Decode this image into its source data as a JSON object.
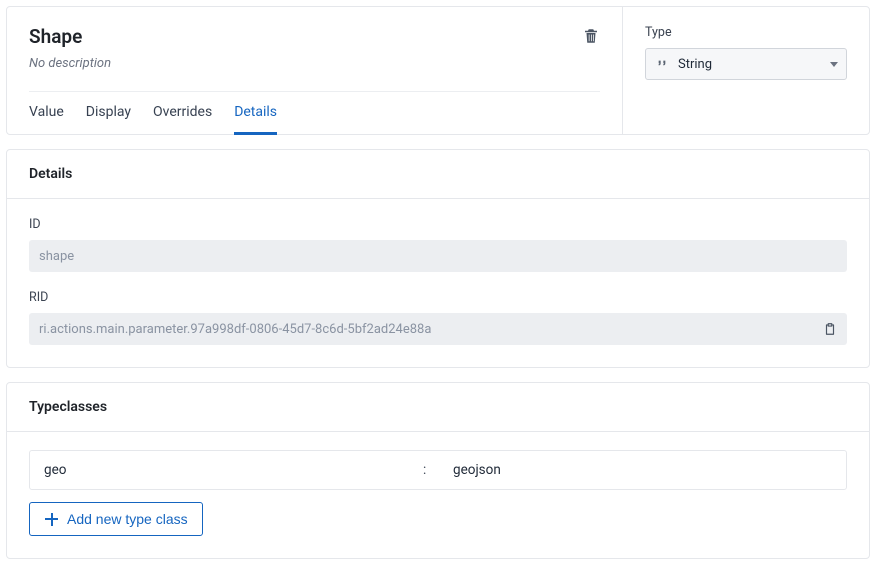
{
  "header": {
    "title": "Shape",
    "description": "No description"
  },
  "tabs": [
    {
      "label": "Value",
      "active": false
    },
    {
      "label": "Display",
      "active": false
    },
    {
      "label": "Overrides",
      "active": false
    },
    {
      "label": "Details",
      "active": true
    }
  ],
  "type_selector": {
    "label": "Type",
    "selected": "String"
  },
  "details": {
    "heading": "Details",
    "id_label": "ID",
    "id_value": "shape",
    "rid_label": "RID",
    "rid_value": "ri.actions.main.parameter.97a998df-0806-45d7-8c6d-5bf2ad24e88a"
  },
  "typeclasses": {
    "heading": "Typeclasses",
    "rows": [
      {
        "key": "geo",
        "value": "geojson"
      }
    ],
    "add_button_label": "Add new type class"
  }
}
